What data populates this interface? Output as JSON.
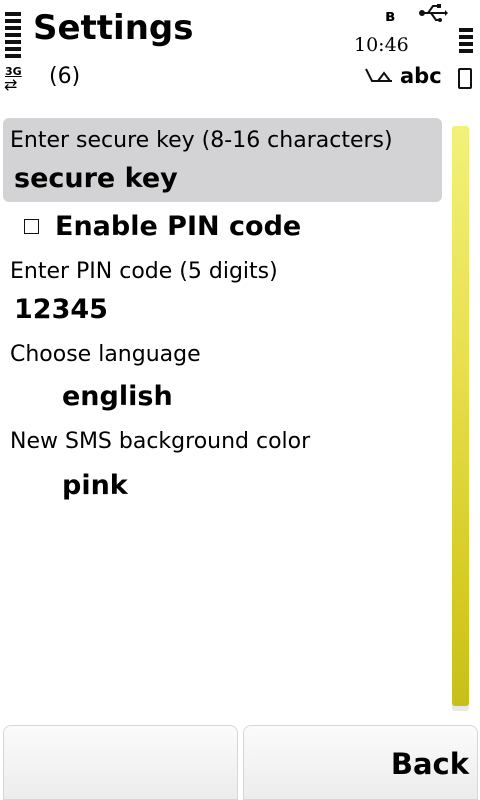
{
  "status_bar": {
    "title": "Settings",
    "time": "10:46",
    "network_badge": "3G",
    "network_arrows": "⇄",
    "message_count": "(6)",
    "input_mode": "abc",
    "icons": [
      "signal-icon",
      "bluetooth-icon",
      "usb-icon",
      "network-3g-icon",
      "input-pen-icon",
      "battery-icon"
    ]
  },
  "form": {
    "secure_key": {
      "label": "Enter secure key (8-16 characters)",
      "value": "secure key"
    },
    "pin_toggle": {
      "label": "Enable PIN code",
      "checked": false
    },
    "pin_code": {
      "label": "Enter PIN code (5 digits)",
      "value": "12345"
    },
    "language": {
      "label": "Choose language",
      "value": "english"
    },
    "sms_color": {
      "label": "New SMS background color",
      "value": "pink"
    }
  },
  "softkeys": {
    "left": "",
    "right": "Back"
  },
  "colors": {
    "focus_background": "#d3d2d4",
    "scrollbar": "#e0d84a"
  }
}
